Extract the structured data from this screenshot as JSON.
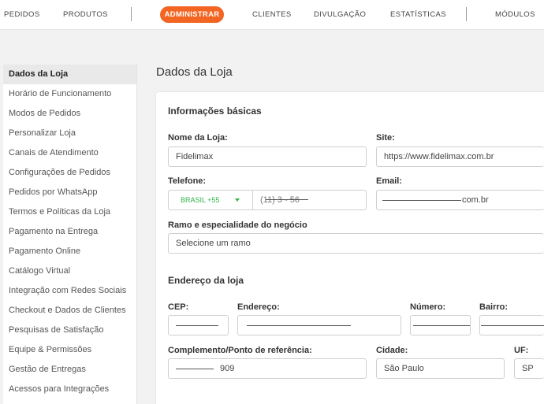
{
  "nav": {
    "items": [
      "PEDIDOS",
      "PRODUTOS",
      "ADMINISTRAR",
      "CLIENTES",
      "DIVULGAÇÃO",
      "ESTATÍSTICAS",
      "MÓDULOS"
    ],
    "active": "ADMINISTRAR",
    "accent_color": "#f26522"
  },
  "sidebar": {
    "items": [
      "Dados da Loja",
      "Horário de Funcionamento",
      "Modos de Pedidos",
      "Personalizar Loja",
      "Canais de Atendimento",
      "Configurações de Pedidos",
      "Pedidos por WhatsApp",
      "Termos e Políticas da Loja",
      "Pagamento na Entrega",
      "Pagamento Online",
      "Catálogo Virtual",
      "Integração com Redes Sociais",
      "Checkout e Dados de Clientes",
      "Pesquisas de Satisfação",
      "Equipe & Permissões",
      "Gestão de Entregas",
      "Acessos para Integrações"
    ],
    "active_index": 0
  },
  "page_title": "Dados da Loja",
  "basic_info": {
    "section_title": "Informações básicas",
    "store_name_label": "Nome da Loja:",
    "store_name_value": "Fidelimax",
    "site_label": "Site:",
    "site_value": "https://www.fidelimax.com.br",
    "phone_label": "Telefone:",
    "phone_country": "BRASIL +55",
    "phone_value": "(11) 3   -  56",
    "email_label": "Email:",
    "email_value": "com.br",
    "segment_label": "Ramo e especialidade do negócio",
    "segment_placeholder": "Selecione um ramo"
  },
  "address": {
    "section_title": "Endereço da loja",
    "cep_label": "CEP:",
    "street_label": "Endereço:",
    "number_label": "Número:",
    "district_label": "Bairro:",
    "complement_label": "Complemento/Ponto de referência:",
    "complement_value": "909",
    "city_label": "Cidade:",
    "city_value": "São Paulo",
    "state_label": "UF:",
    "state_value": "SP"
  },
  "colors": {
    "phone_country": "#2fb34a"
  }
}
